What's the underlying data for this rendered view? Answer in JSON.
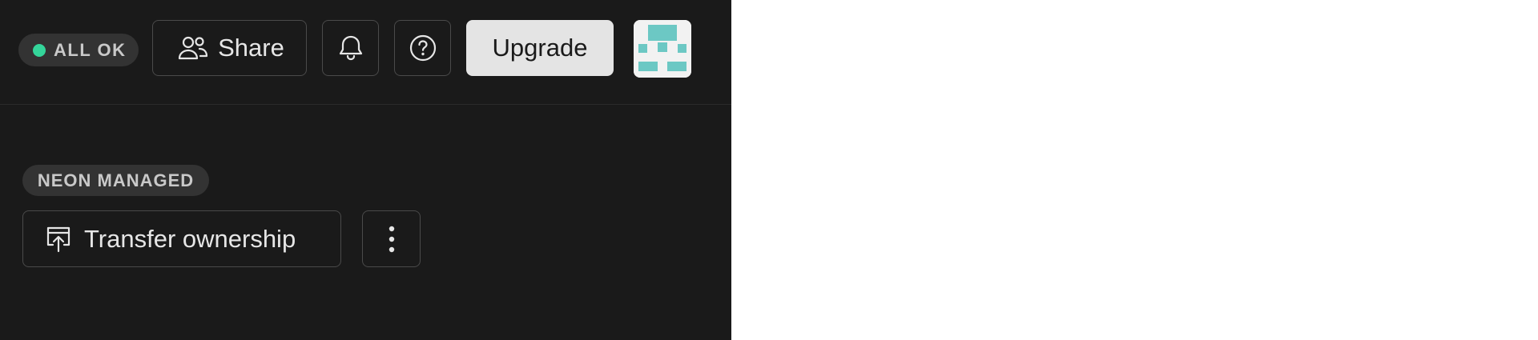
{
  "header": {
    "status": {
      "label": "ALL OK",
      "dot_color": "#34d59a"
    },
    "share_label": "Share",
    "bell_icon": "bell-icon",
    "help_icon": "help-circle-icon",
    "upgrade_label": "Upgrade",
    "avatar_colors": [
      "#6cc8c4",
      "#f2f2f2"
    ]
  },
  "section": {
    "badge_label": "NEON MANAGED",
    "transfer_label": "Transfer ownership",
    "transfer_icon": "upload-box-icon",
    "more_icon": "vertical-dots-icon"
  },
  "colors": {
    "panel_bg": "#1a1a1a",
    "border": "#4a4a4a",
    "pill_bg": "#333333",
    "upgrade_bg": "#e4e4e4"
  }
}
